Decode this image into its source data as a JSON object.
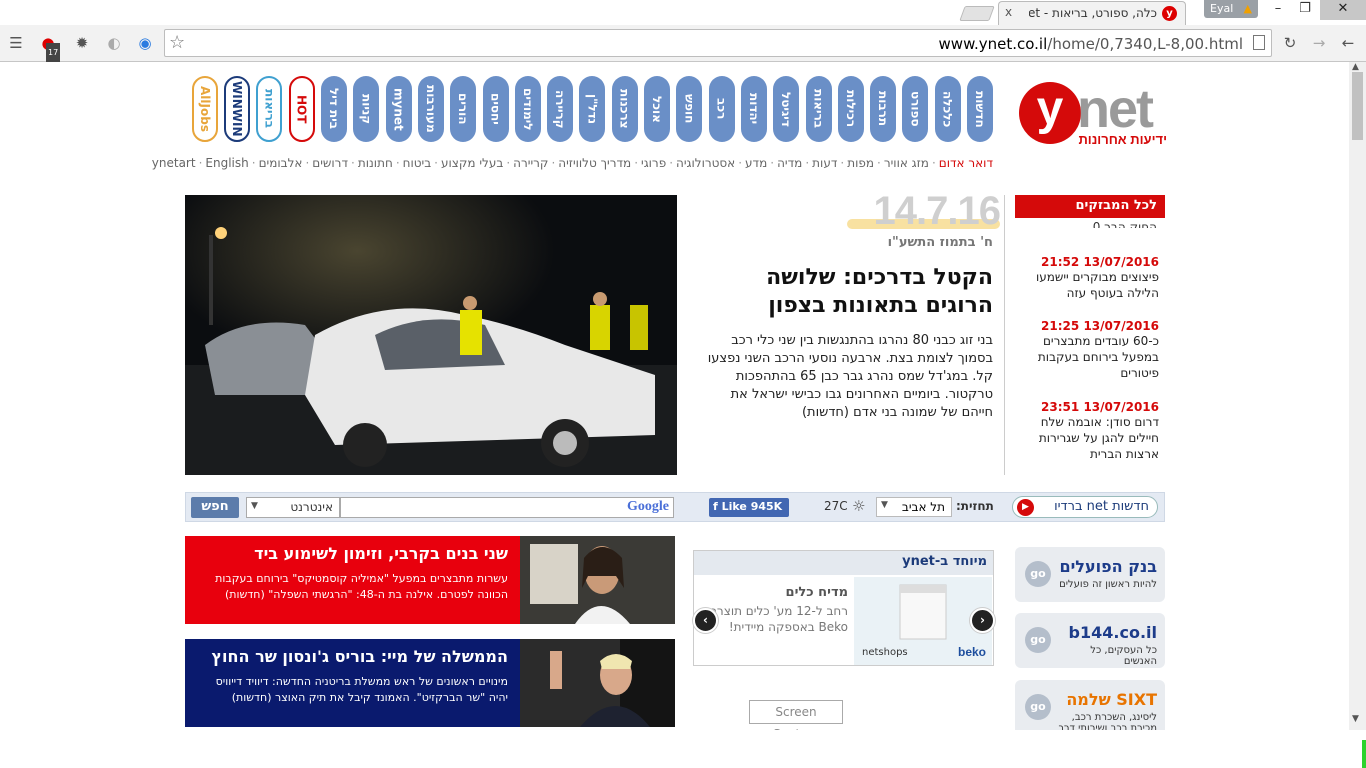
{
  "browser": {
    "tab_title": "כלה, ספורט, בריאות - ynet",
    "tab_close": "x",
    "user_name": "Eyal",
    "address": {
      "host": "www.ynet.co.il",
      "path": "/home/0,7340,L-8,00.html"
    },
    "badge_count": "17"
  },
  "logo": {
    "y": "y",
    "net": "net",
    "sub": "ידיעות אחרונות"
  },
  "nav_pills": [
    "חדשות",
    "כלכלה",
    "ספורט",
    "תרבות",
    "רכילות",
    "בריאות",
    "דיגיטל",
    "יהדות",
    "רכב",
    "חופש",
    "אוכל",
    "צרכנות",
    "נדל\"ן",
    "קריירה",
    "לימודים",
    "יחסים",
    "הורים",
    "מעורבות",
    "mynet",
    "קניות",
    "בית דיל"
  ],
  "brand_pills": [
    "HOT",
    "בריאות",
    "WINWIN",
    "AllJobs"
  ],
  "sublinks": [
    "דואר אדום",
    "מזג אוויר",
    "מפות",
    "דעות",
    "מדיה",
    "מדע",
    "אסטרולוגיה",
    "פרוגי",
    "מדריך טלוויזיה",
    "קריירה",
    "בעלי מקצוע",
    "ביטוח",
    "חתונות",
    "דרושים",
    "אלבומים",
    "ynetart",
    "English"
  ],
  "ticker": {
    "header": "לכל המבזקים",
    "cut_text": "החוק הבר 0",
    "items": [
      {
        "time": "13/07/2016 21:52",
        "text": "פיצוצים מבוקרים יישמעו הלילה בעוטף עזה"
      },
      {
        "time": "13/07/2016 21:25",
        "text": "כ-60 עובדים מתבצרים במפעל בירוחם בעקבות פיטורים"
      },
      {
        "time": "13/07/2016 23:51",
        "text": "דרום סודן: אובמה שלח חיילים להגן על שגרירות ארצות הברית"
      }
    ]
  },
  "main_story": {
    "date_big": "14.7.16",
    "hebrew_date": "ח' בתמוז התשע\"ו",
    "headline": "הקטל בדרכים: שלושה הרוגים בתאונות בצפון",
    "summary": "בני זוג כבני 80 נהרגו בהתנגשות בין שני כלי רכב בסמוך לצומת בצת. ארבעה נוסעי הרכב השני נפצעו קל. במג'דל שמס נהרג גבר כבן 65 בהתהפכות טרקטור. ביומיים האחרונים גבו כבישי ישראל את חייהם של שמונה בני אדם (חדשות)"
  },
  "search_bar": {
    "news_label": "חדשות net ברדיו",
    "forecast_label": "תחזית:",
    "city": "תל אביב",
    "temperature": "27C",
    "like_label": "Like 945K",
    "google_label": "Google",
    "scope": "אינטרנט",
    "search_button": "חפש"
  },
  "promos": [
    {
      "title": "שני בנים בקרבי, וזימון לשימוע ביד",
      "desc": "עשרות מתבצרים במפעל \"אמיליה קוסמטיקס\" בירוחם בעקבות הכוונה לפטרם. אילנה בת ה-48: \"הרגשתי השפלה\" (חדשות)",
      "color": "#e8000d"
    },
    {
      "title": "הממשלה של מיי: בוריס ג'ונסון שר החוץ",
      "desc": "מינויים ראשונים של ראש ממשלת בריטניה החדשה: דיוויד דייוויס יהיה \"שר הברקזיט\". האמונד קיבל את תיק האוצר (חדשות)",
      "color": "#0a1a6e"
    }
  ],
  "special": {
    "header": "מיוחד ב-ynet",
    "title": "מדיח כלים",
    "desc": "רחב ל-12 מע' כלים תוצרת Beko באספקה מיידית!",
    "brand_left": "netshops",
    "brand_right": "beko",
    "next": "›",
    "prev": "‹"
  },
  "ads": [
    {
      "name": "בנק הפועלים",
      "tag": "להיות ראשון זה פועלים",
      "go": "go",
      "color": "#1d3c8a"
    },
    {
      "name": "b144.co.il",
      "tag": "כל העסקים, כל האנשים",
      "go": "go",
      "color": "#1d3c8a"
    },
    {
      "name": "SIXT שלמה",
      "tag": "ליסינג, השכרת רכב, מכירת רכב ושירותי דרך",
      "go": "go",
      "color": "#e87400"
    }
  ],
  "screen_capture": "Screen Capture"
}
